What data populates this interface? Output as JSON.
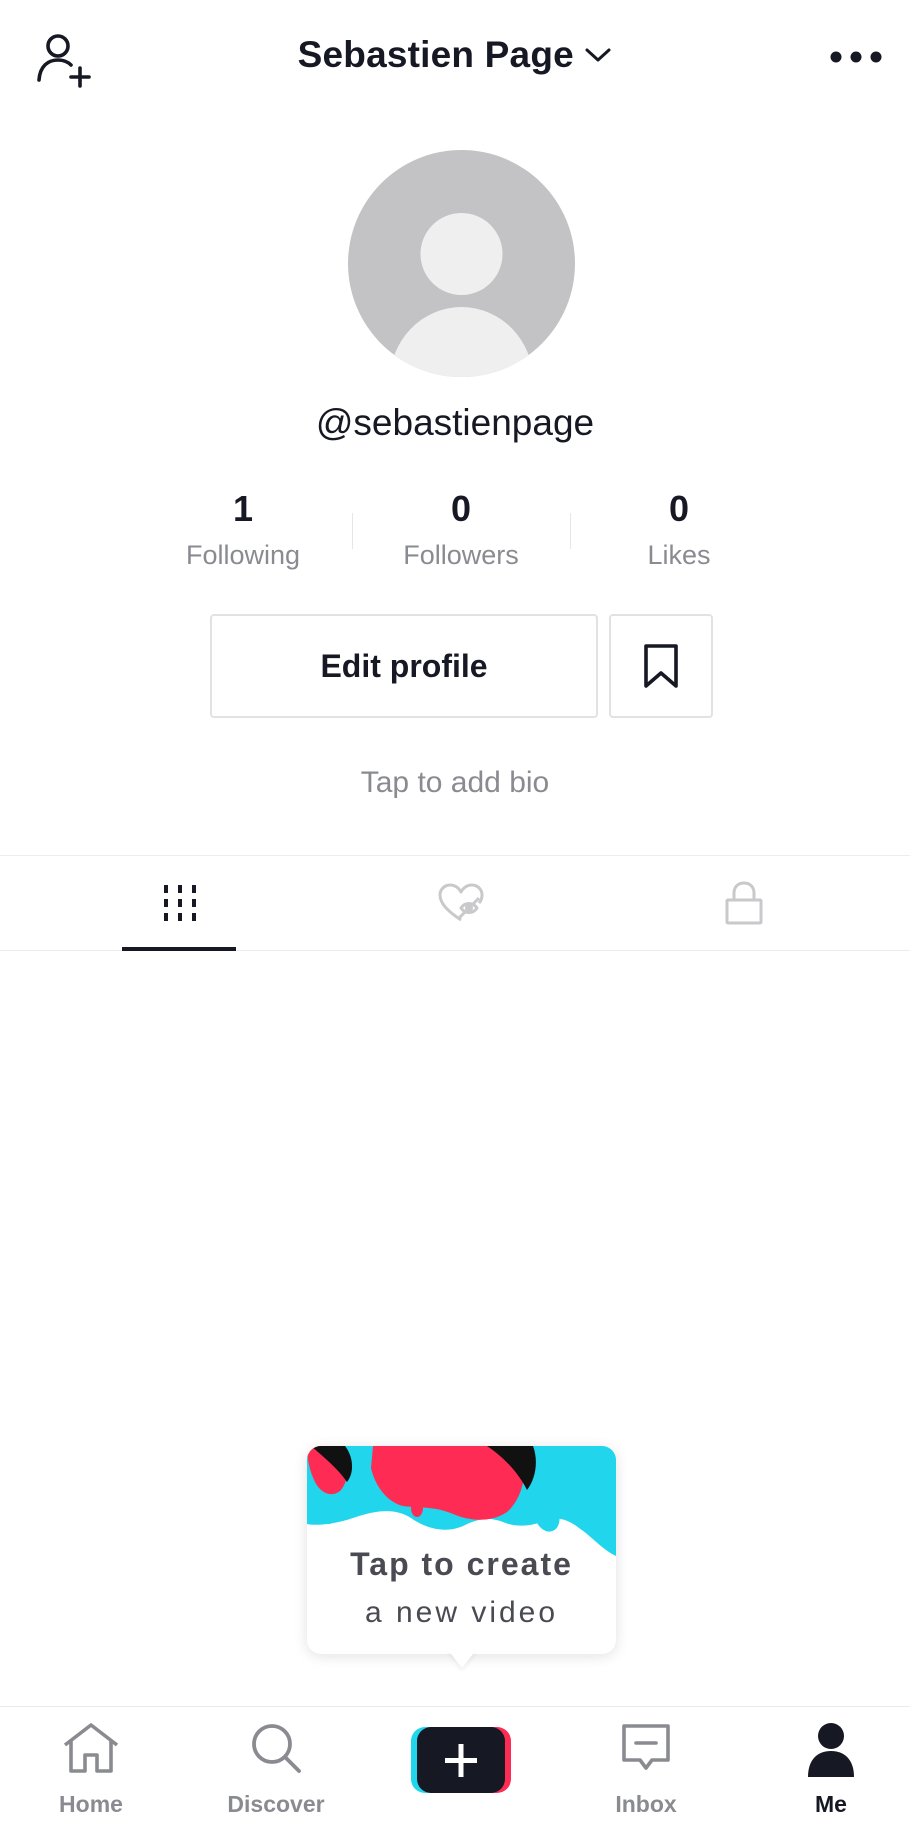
{
  "header": {
    "title": "Sebastien Page"
  },
  "profile": {
    "username": "@sebastienpage",
    "bio_placeholder": "Tap to add bio"
  },
  "stats": [
    {
      "value": "1",
      "label": "Following"
    },
    {
      "value": "0",
      "label": "Followers"
    },
    {
      "value": "0",
      "label": "Likes"
    }
  ],
  "actions": {
    "edit_profile": "Edit profile"
  },
  "tabs": [
    {
      "icon": "videos-grid-icon",
      "active": true
    },
    {
      "icon": "liked-private-icon",
      "active": false
    },
    {
      "icon": "lock-icon",
      "active": false
    }
  ],
  "create_tip": {
    "line1": "Tap to create",
    "line2": "a new video"
  },
  "bottom_nav": [
    {
      "label": "Home",
      "icon": "home-icon",
      "active": false
    },
    {
      "label": "Discover",
      "icon": "search-icon",
      "active": false
    },
    {
      "label": "",
      "icon": "create-plus-icon",
      "active": false
    },
    {
      "label": "Inbox",
      "icon": "inbox-icon",
      "active": false
    },
    {
      "label": "Me",
      "icon": "profile-icon",
      "active": true
    }
  ],
  "colors": {
    "text": "#161823",
    "secondary_text": "#8a8b91",
    "avatar_bg": "#c3c3c6",
    "accent_cyan": "#20d5ec",
    "accent_red": "#fe2c55"
  }
}
